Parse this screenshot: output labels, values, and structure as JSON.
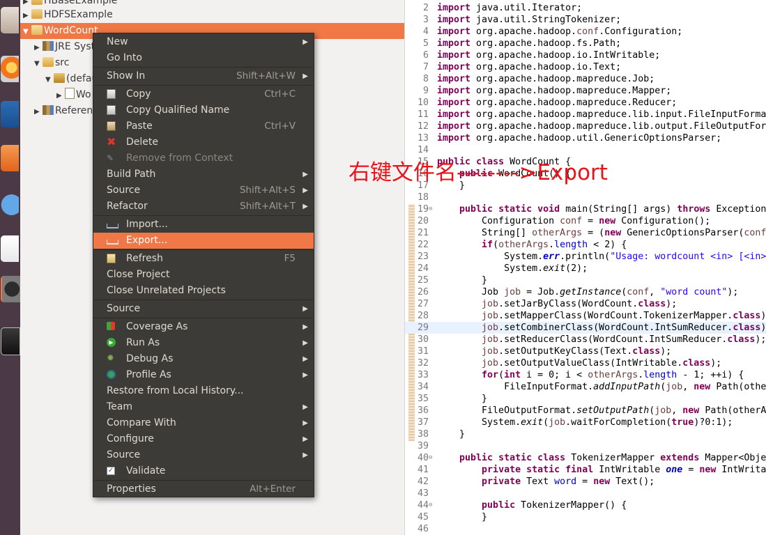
{
  "explorer": {
    "items": [
      {
        "label": "HBaseExample",
        "arrow": "▶"
      },
      {
        "label": "HDFSExample",
        "arrow": "▶"
      },
      {
        "label": "WordCount",
        "arrow": "▼"
      },
      {
        "label": "JRE Syst",
        "arrow": "▶"
      },
      {
        "label": "src",
        "arrow": "▼"
      },
      {
        "label": "(defau",
        "arrow": "▼"
      },
      {
        "label": "Wo",
        "arrow": "▶"
      },
      {
        "label": "Referen",
        "arrow": "▶"
      }
    ]
  },
  "menu": {
    "items": [
      {
        "label": "New",
        "shortcut": "",
        "submenu": "▶"
      },
      {
        "label": "Go Into",
        "shortcut": ""
      },
      {
        "label": "Show In",
        "shortcut": "Shift+Alt+W",
        "submenu": "▶"
      },
      {
        "label": "Copy",
        "shortcut": "Ctrl+C"
      },
      {
        "label": "Copy Qualified Name",
        "shortcut": ""
      },
      {
        "label": "Paste",
        "shortcut": "Ctrl+V"
      },
      {
        "label": "Delete",
        "shortcut": ""
      },
      {
        "label": "Remove from Context",
        "shortcut": ""
      },
      {
        "label": "Build Path",
        "shortcut": "",
        "submenu": "▶"
      },
      {
        "label": "Source",
        "shortcut": "Shift+Alt+S",
        "submenu": "▶"
      },
      {
        "label": "Refactor",
        "shortcut": "Shift+Alt+T",
        "submenu": "▶"
      },
      {
        "label": "Import...",
        "shortcut": ""
      },
      {
        "label": "Export...",
        "shortcut": ""
      },
      {
        "label": "Refresh",
        "shortcut": "F5"
      },
      {
        "label": "Close Project",
        "shortcut": ""
      },
      {
        "label": "Close Unrelated Projects",
        "shortcut": ""
      },
      {
        "label": "Source",
        "shortcut": "",
        "submenu": "▶"
      },
      {
        "label": "Coverage As",
        "shortcut": "",
        "submenu": "▶"
      },
      {
        "label": "Run As",
        "shortcut": "",
        "submenu": "▶"
      },
      {
        "label": "Debug As",
        "shortcut": "",
        "submenu": "▶"
      },
      {
        "label": "Profile As",
        "shortcut": "",
        "submenu": "▶"
      },
      {
        "label": "Restore from Local History...",
        "shortcut": ""
      },
      {
        "label": "Team",
        "shortcut": "",
        "submenu": "▶"
      },
      {
        "label": "Compare With",
        "shortcut": "",
        "submenu": "▶"
      },
      {
        "label": "Configure",
        "shortcut": "",
        "submenu": "▶"
      },
      {
        "label": "Source",
        "shortcut": "",
        "submenu": "▶"
      },
      {
        "label": "Validate",
        "shortcut": ""
      },
      {
        "label": "Properties",
        "shortcut": "Alt+Enter"
      }
    ]
  },
  "annotation": "右键文件名-------->Export",
  "editor": {
    "lines": [
      {
        "n": "2",
        "code": "import java.util.Iterator;"
      },
      {
        "n": "3",
        "code": "import java.util.StringTokenizer;"
      },
      {
        "n": "4",
        "code": "import org.apache.hadoop.conf.Configuration;"
      },
      {
        "n": "5",
        "code": "import org.apache.hadoop.fs.Path;"
      },
      {
        "n": "6",
        "code": "import org.apache.hadoop.io.IntWritable;"
      },
      {
        "n": "7",
        "code": "import org.apache.hadoop.io.Text;"
      },
      {
        "n": "8",
        "code": "import org.apache.hadoop.mapreduce.Job;"
      },
      {
        "n": "9",
        "code": "import org.apache.hadoop.mapreduce.Mapper;"
      },
      {
        "n": "10",
        "code": "import org.apache.hadoop.mapreduce.Reducer;"
      },
      {
        "n": "11",
        "code": "import org.apache.hadoop.mapreduce.lib.input.FileInputFormat"
      },
      {
        "n": "12",
        "code": "import org.apache.hadoop.mapreduce.lib.output.FileOutputForm"
      },
      {
        "n": "13",
        "code": "import org.apache.hadoop.util.GenericOptionsParser;"
      },
      {
        "n": "14",
        "code": ""
      },
      {
        "n": "15",
        "code": "public class WordCount {"
      },
      {
        "n": "16",
        "code": "    public WordCount() {"
      },
      {
        "n": "17",
        "code": "    }"
      },
      {
        "n": "18",
        "code": ""
      },
      {
        "n": "19",
        "code": "    public static void main(String[] args) throws Exception"
      },
      {
        "n": "20",
        "code": "        Configuration conf = new Configuration();"
      },
      {
        "n": "21",
        "code": "        String[] otherArgs = (new GenericOptionsParser(conf"
      },
      {
        "n": "22",
        "code": "        if(otherArgs.length < 2) {"
      },
      {
        "n": "23",
        "code": "            System.err.println(\"Usage: wordcount <in> [<in>"
      },
      {
        "n": "24",
        "code": "            System.exit(2);"
      },
      {
        "n": "25",
        "code": "        }"
      },
      {
        "n": "26",
        "code": "        Job job = Job.getInstance(conf, \"word count\");"
      },
      {
        "n": "27",
        "code": "        job.setJarByClass(WordCount.class);"
      },
      {
        "n": "28",
        "code": "        job.setMapperClass(WordCount.TokenizerMapper.class)"
      },
      {
        "n": "29",
        "code": "        job.setCombinerClass(WordCount.IntSumReducer.class)"
      },
      {
        "n": "30",
        "code": "        job.setReducerClass(WordCount.IntSumReducer.class);"
      },
      {
        "n": "31",
        "code": "        job.setOutputKeyClass(Text.class);"
      },
      {
        "n": "32",
        "code": "        job.setOutputValueClass(IntWritable.class);"
      },
      {
        "n": "33",
        "code": "        for(int i = 0; i < otherArgs.length - 1; ++i) {"
      },
      {
        "n": "34",
        "code": "            FileInputFormat.addInputPath(job, new Path(othe"
      },
      {
        "n": "35",
        "code": "        }"
      },
      {
        "n": "36",
        "code": "        FileOutputFormat.setOutputPath(job, new Path(otherA"
      },
      {
        "n": "37",
        "code": "        System.exit(job.waitForCompletion(true)?0:1);"
      },
      {
        "n": "38",
        "code": "    }"
      },
      {
        "n": "39",
        "code": ""
      },
      {
        "n": "40",
        "code": "    public static class TokenizerMapper extends Mapper<Obje"
      },
      {
        "n": "41",
        "code": "        private static final IntWritable one = new IntWrita"
      },
      {
        "n": "42",
        "code": "        private Text word = new Text();"
      },
      {
        "n": "43",
        "code": ""
      },
      {
        "n": "44",
        "code": "        public TokenizerMapper() {"
      },
      {
        "n": "45",
        "code": "        }"
      },
      {
        "n": "46",
        "code": ""
      }
    ]
  },
  "colors": {
    "selection": "#f07746",
    "menu_bg": "#3c3b37",
    "annotation": "#e8141a",
    "keyword": "#7f0055",
    "string": "#2a00ff"
  }
}
